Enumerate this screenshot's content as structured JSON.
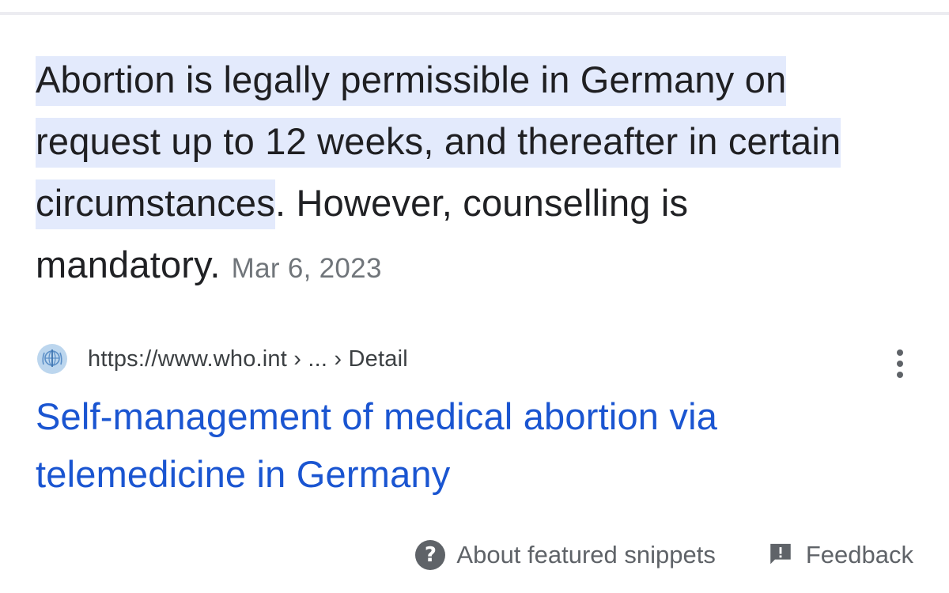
{
  "snippet": {
    "highlighted_text": "Abortion is legally permissible in Germany on request up to 12 weeks, and thereafter in certain circumstances",
    "rest_text": ". However, counselling is mandatory.",
    "date": "Mar 6, 2023"
  },
  "source": {
    "favicon": "who-globe-icon",
    "url_breadcrumb": "https://www.who.int › ... › Detail",
    "more_icon": "vertical-dots-icon"
  },
  "result": {
    "title": "Self-management of medical abortion via telemedicine in Germany"
  },
  "footer": {
    "about_icon": "question-circle-icon",
    "about_label": "About featured snippets",
    "feedback_icon": "feedback-flag-icon",
    "feedback_label": "Feedback"
  },
  "colors": {
    "highlight": "#e3eafc",
    "link": "#1a55d1",
    "secondary_text": "#70757a"
  }
}
